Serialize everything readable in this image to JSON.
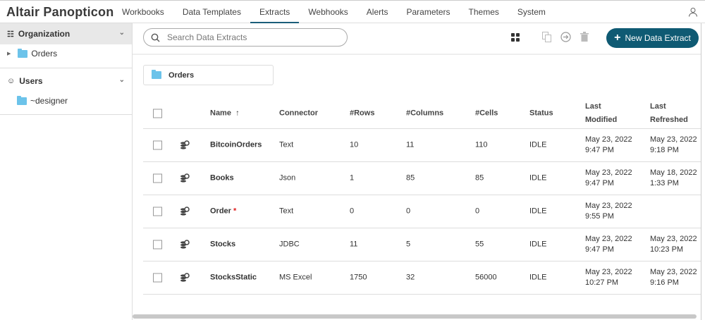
{
  "app": {
    "title": "Altair Panopticon"
  },
  "nav": [
    "Workbooks",
    "Data Templates",
    "Extracts",
    "Webhooks",
    "Alerts",
    "Parameters",
    "Themes",
    "System"
  ],
  "sidebar": {
    "organization": "Organization",
    "org_items": [
      "Orders"
    ],
    "users": "Users",
    "user_items": [
      "~designer"
    ]
  },
  "toolbar": {
    "search_placeholder": "Search Data Extracts",
    "new_button": "New Data Extract"
  },
  "breadcrumb": "Orders",
  "table": {
    "headers": {
      "name": "Name",
      "connector": "Connector",
      "rows": "#Rows",
      "columns": "#Columns",
      "cells": "#Cells",
      "status": "Status",
      "modified_1": "Last",
      "modified_2": "Modified",
      "refreshed_1": "Last",
      "refreshed_2": "Refreshed"
    },
    "rows": [
      {
        "name": "BitcoinOrders",
        "star": "",
        "connector": "Text",
        "rows": "10",
        "columns": "11",
        "cells": "110",
        "status": "IDLE",
        "mod_date": "May 23, 2022",
        "mod_time": "9:47 PM",
        "ref_date": "May 23, 2022",
        "ref_time": "9:18 PM"
      },
      {
        "name": "Books",
        "star": "",
        "connector": "Json",
        "rows": "1",
        "columns": "85",
        "cells": "85",
        "status": "IDLE",
        "mod_date": "May 23, 2022",
        "mod_time": "9:47 PM",
        "ref_date": "May 18, 2022",
        "ref_time": "1:33 PM"
      },
      {
        "name": "Order",
        "star": "*",
        "connector": "Text",
        "rows": "0",
        "columns": "0",
        "cells": "0",
        "status": "IDLE",
        "mod_date": "May 23, 2022",
        "mod_time": "9:55 PM",
        "ref_date": "",
        "ref_time": ""
      },
      {
        "name": "Stocks",
        "star": "",
        "connector": "JDBC",
        "rows": "11",
        "columns": "5",
        "cells": "55",
        "status": "IDLE",
        "mod_date": "May 23, 2022",
        "mod_time": "9:47 PM",
        "ref_date": "May 23, 2022",
        "ref_time": "10:23 PM"
      },
      {
        "name": "StocksStatic",
        "star": "",
        "connector": "MS Excel",
        "rows": "1750",
        "columns": "32",
        "cells": "56000",
        "status": "IDLE",
        "mod_date": "May 23, 2022",
        "mod_time": "10:27 PM",
        "ref_date": "May 23, 2022",
        "ref_time": "9:16 PM"
      }
    ]
  }
}
